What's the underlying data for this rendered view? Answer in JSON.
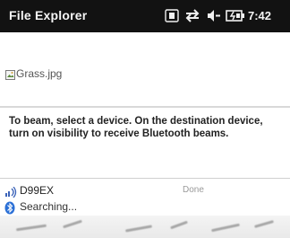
{
  "titlebar": {
    "title": "File Explorer",
    "time": "7:42",
    "status_icons": [
      "keyboard-icon",
      "sync-arrows-icon",
      "volume-icon",
      "battery-charging-icon"
    ]
  },
  "file": {
    "icon": "image-file-icon",
    "name": "Grass.jpg"
  },
  "instructions": {
    "text": "To beam, select a device. On the destination device, turn on visibility to receive Bluetooth beams."
  },
  "devices": [
    {
      "icon": "device-signal-icon",
      "name": "D99EX",
      "status": "Done"
    }
  ],
  "searching": {
    "icon": "bluetooth-icon",
    "text": "Searching..."
  },
  "colors": {
    "titlebar_bg": "#121212",
    "titlebar_text": "#f5f5f5",
    "bluetooth_blue": "#2a6fd6"
  }
}
